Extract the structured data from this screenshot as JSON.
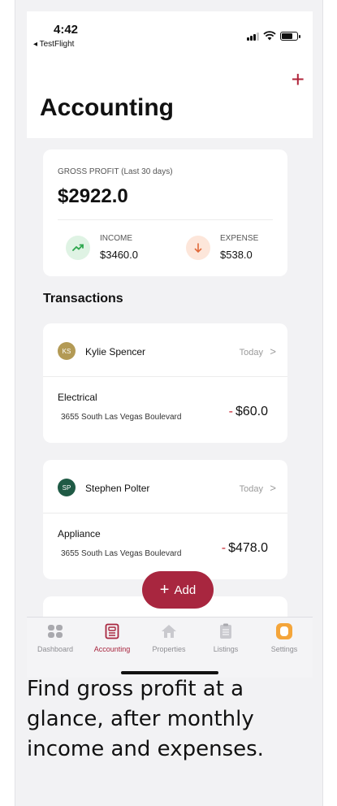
{
  "status_bar": {
    "time": "4:42",
    "back_app": "◂ TestFlight"
  },
  "header": {
    "add_icon": "plus-icon",
    "title": "Accounting"
  },
  "gross_profit": {
    "label": "GROSS PROFIT (Last 30 days)",
    "value": "$2922.0",
    "income": {
      "label": "INCOME",
      "value": "$3460.0",
      "icon": "trend-up-icon",
      "color": "#2fa84f",
      "bg": "#dff3e4"
    },
    "expense": {
      "label": "EXPENSE",
      "value": "$538.0",
      "icon": "arrow-down-icon",
      "color": "#e0693a",
      "bg": "#fde6da"
    }
  },
  "transactions": {
    "title": "Transactions",
    "items": [
      {
        "initials": "KS",
        "name": "Kylie Spencer",
        "date": "Today",
        "category": "Electrical",
        "address": "3655 South Las Vegas Boulevard",
        "amount_sign": "-",
        "amount": "$60.0",
        "avatar_color": "#b39a55"
      },
      {
        "initials": "SP",
        "name": "Stephen Polter",
        "date": "Today",
        "category": "Appliance",
        "address": "3655 South Las Vegas Boulevard",
        "amount_sign": "-",
        "amount": "$478.0",
        "avatar_color": "#1f5a45"
      }
    ]
  },
  "add_button": {
    "label": "Add",
    "icon": "plus-icon"
  },
  "tabs": [
    {
      "label": "Dashboard",
      "icon": "dashboard-icon",
      "active": false
    },
    {
      "label": "Accounting",
      "icon": "accounting-icon",
      "active": true
    },
    {
      "label": "Properties",
      "icon": "home-icon",
      "active": false
    },
    {
      "label": "Listings",
      "icon": "clipboard-icon",
      "active": false
    },
    {
      "label": "Settings",
      "icon": "settings-icon",
      "active": false
    }
  ],
  "colors": {
    "accent": "#a8263f",
    "minus": "#c8232f",
    "settings": "#f4a53a"
  },
  "caption": "Find gross profit at a glance, after monthly income and expenses."
}
